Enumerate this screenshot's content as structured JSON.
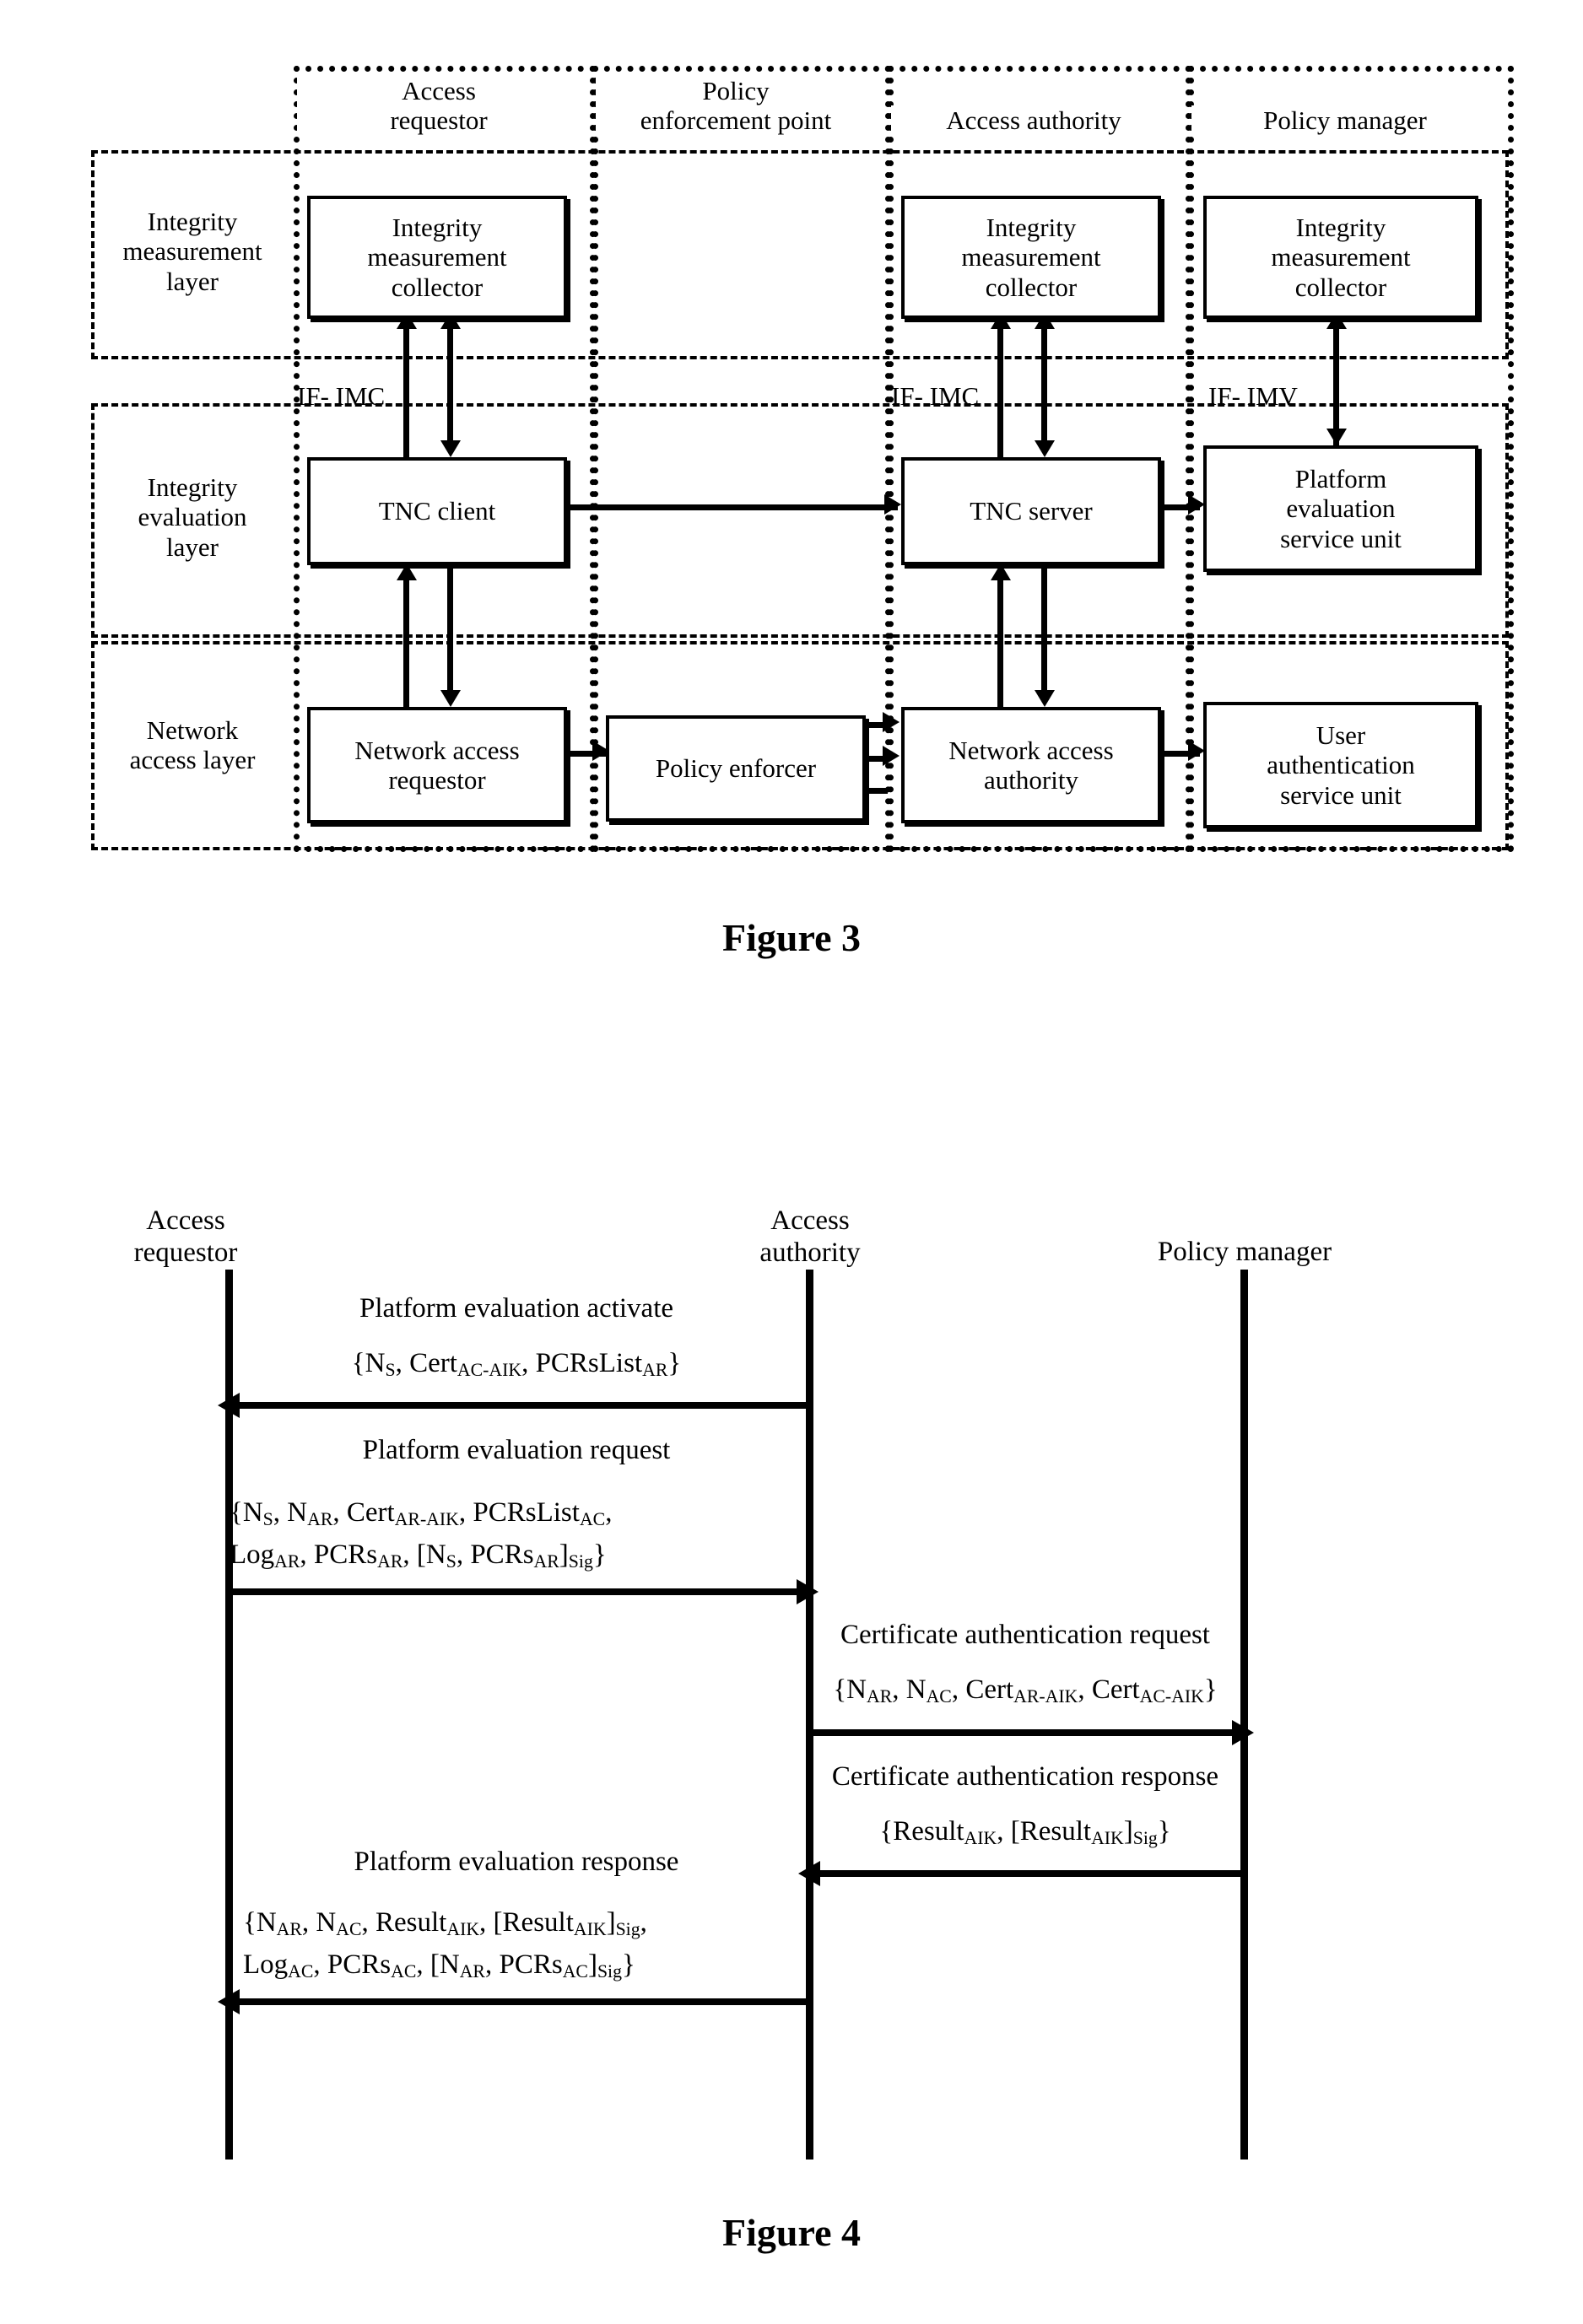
{
  "figure3": {
    "caption": "Figure 3",
    "layers": [
      {
        "id": "integrity-measurement-layer",
        "label": "Integrity\nmeasurement\nlayer"
      },
      {
        "id": "integrity-evaluation-layer",
        "label": "Integrity\nevaluation\nlayer"
      },
      {
        "id": "network-access-layer",
        "label": "Network\naccess layer"
      }
    ],
    "entities": [
      {
        "id": "access-requestor",
        "label": "Access\nrequestor"
      },
      {
        "id": "policy-enforcement-point",
        "label": "Policy\nenforcement point"
      },
      {
        "id": "access-authority",
        "label": "Access authority"
      },
      {
        "id": "policy-manager",
        "label": "Policy manager"
      }
    ],
    "components": [
      {
        "id": "ar-imc",
        "label": "Integrity\nmeasurement\ncollector"
      },
      {
        "id": "aa-imc",
        "label": "Integrity\nmeasurement\ncollector"
      },
      {
        "id": "pm-imc",
        "label": "Integrity\nmeasurement\ncollector"
      },
      {
        "id": "tnc-client",
        "label": "TNC client"
      },
      {
        "id": "tnc-server",
        "label": "TNC server"
      },
      {
        "id": "platform-evaluation-service-unit",
        "label": "Platform\nevaluation\nservice unit"
      },
      {
        "id": "network-access-requestor",
        "label": "Network access\nrequestor"
      },
      {
        "id": "policy-enforcer",
        "label": "Policy enforcer"
      },
      {
        "id": "network-access-authority",
        "label": "Network access\nauthority"
      },
      {
        "id": "user-authentication-service-unit",
        "label": "User\nauthentication\nservice unit"
      }
    ],
    "interfaces": [
      {
        "id": "if-imc-left",
        "label": "IF- IMC"
      },
      {
        "id": "if-imc-right",
        "label": "IF- IMC"
      },
      {
        "id": "if-imv",
        "label": "IF- IMV"
      }
    ]
  },
  "figure4": {
    "caption": "Figure 4",
    "lifelines": [
      {
        "id": "access-requestor",
        "label": "Access\nrequestor"
      },
      {
        "id": "access-authority",
        "label": "Access\nauthority"
      },
      {
        "id": "policy-manager",
        "label": "Policy manager"
      }
    ],
    "messages": [
      {
        "id": "platform-evaluation-activate",
        "title": "Platform evaluation activate",
        "payload": "{N_S, Cert_AC-AIK, PCRsList_AR}",
        "from": "access-authority",
        "to": "access-requestor",
        "direction": "left"
      },
      {
        "id": "platform-evaluation-request",
        "title": "Platform evaluation request",
        "payload": "{N_S, N_AR, Cert_AR-AIK, PCRsList_AC, Log_AR, PCRs_AR, [N_S, PCRs_AR]_Sig}",
        "from": "access-requestor",
        "to": "access-authority",
        "direction": "right"
      },
      {
        "id": "certificate-authentication-request",
        "title": "Certificate authentication request",
        "payload": "{N_AR, N_AC, Cert_AR-AIK, Cert_AC-AIK}",
        "from": "access-authority",
        "to": "policy-manager",
        "direction": "right"
      },
      {
        "id": "certificate-authentication-response",
        "title": "Certificate authentication response",
        "payload": "{Result_AIK, [Result_AIK]_Sig}",
        "from": "policy-manager",
        "to": "access-authority",
        "direction": "left"
      },
      {
        "id": "platform-evaluation-response",
        "title": "Platform evaluation response",
        "payload": "{N_AR, N_AC, Result_AIK, [Result_AIK]_Sig, Log_AC, PCRs_AC, [N_AR, PCRs_AC]_Sig}",
        "from": "access-authority",
        "to": "access-requestor",
        "direction": "left"
      }
    ]
  }
}
